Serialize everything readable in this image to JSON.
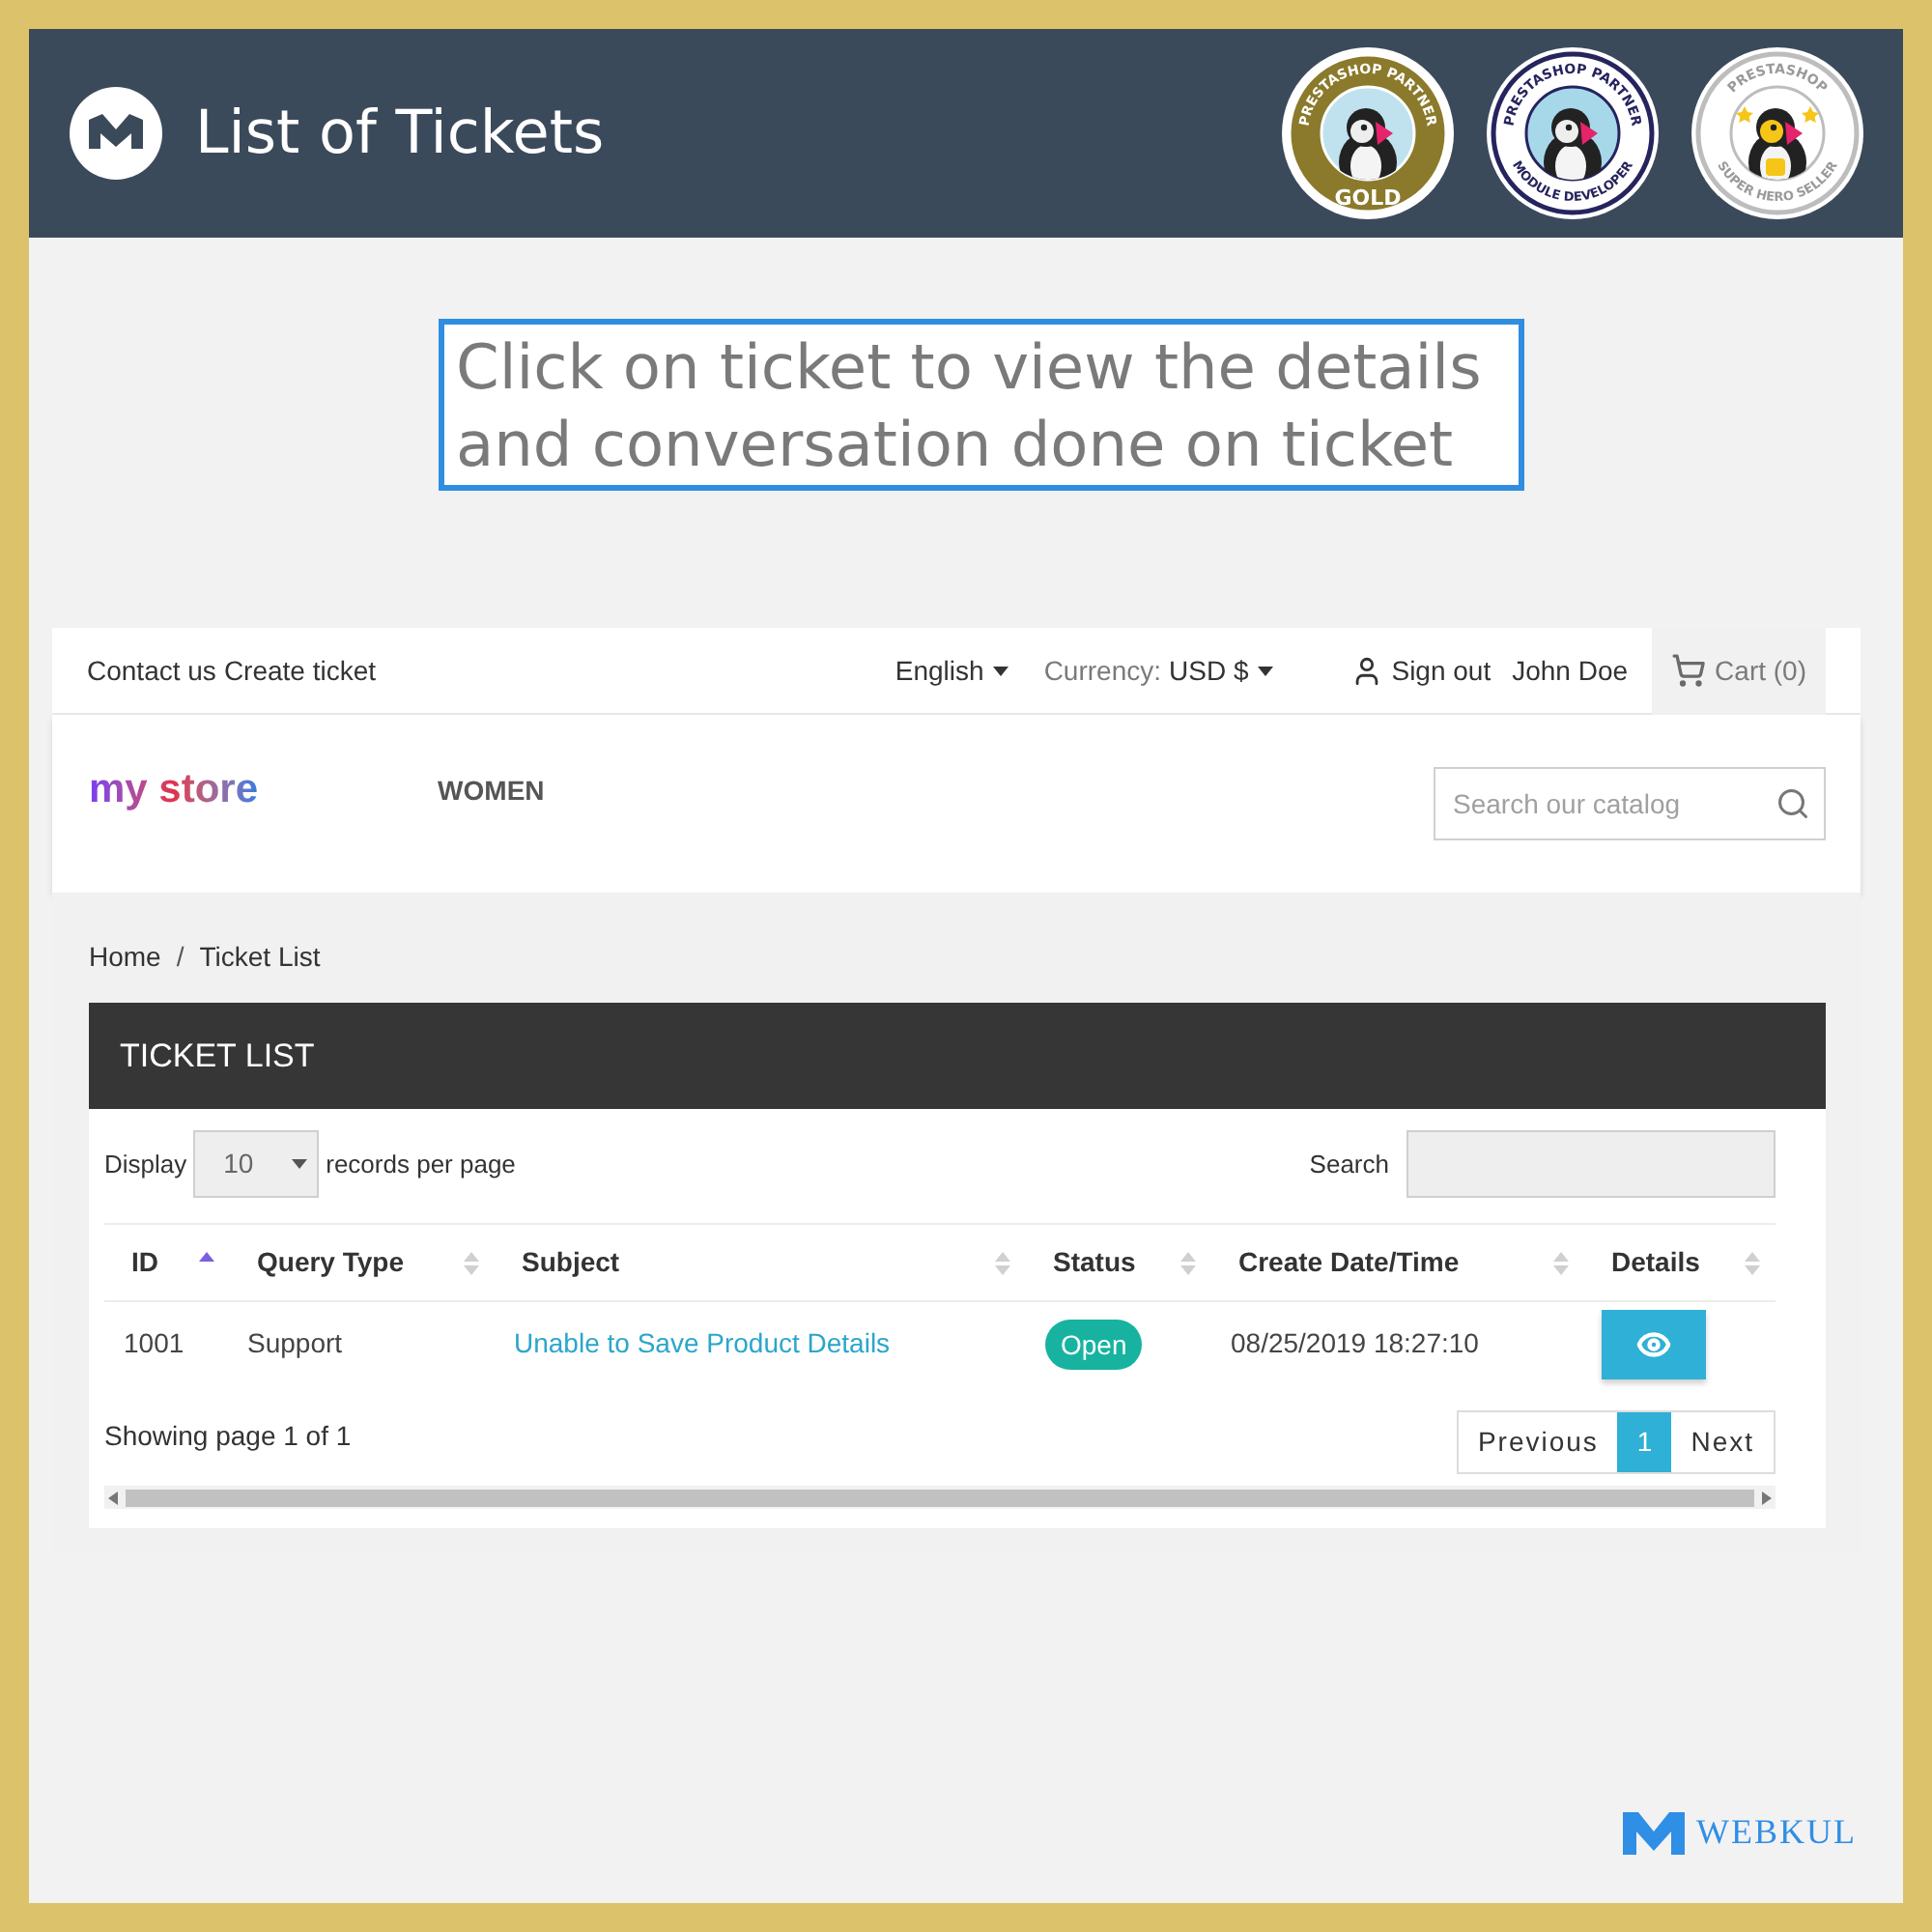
{
  "header": {
    "title": "List of Tickets",
    "badges": [
      {
        "kind": "gold",
        "top_text": "PRESTASHOP PARTNER",
        "bottom_text": "GOLD"
      },
      {
        "kind": "module",
        "top_text": "PRESTASHOP PARTNER",
        "bottom_text": "MODULE DEVELOPER"
      },
      {
        "kind": "hero",
        "top_text": "PRESTASHOP",
        "bottom_text": "SUPER HERO SELLER"
      }
    ]
  },
  "callout": {
    "text": "Click on ticket to view the details and conversation done on ticket"
  },
  "store": {
    "top_links": [
      "Contact us",
      "Create ticket"
    ],
    "language": "English",
    "currency_label": "Currency:",
    "currency": "USD $",
    "sign_out": "Sign out",
    "user_name": "John Doe",
    "cart": "Cart (0)",
    "logo": "my store",
    "menu": [
      "WOMEN"
    ],
    "search": {
      "placeholder": "Search our catalog"
    },
    "breadcrumb": [
      "Home",
      "Ticket List"
    ],
    "breadcrumb_separator": "/"
  },
  "ticket_list": {
    "title": "TICKET LIST",
    "display_label": "Display",
    "page_size": "10",
    "per_page_label": "records per page",
    "search_label": "Search",
    "columns": [
      {
        "label": "ID",
        "sorted": true
      },
      {
        "label": "Query Type",
        "sorted": false
      },
      {
        "label": "Subject",
        "sorted": false
      },
      {
        "label": "Status",
        "sorted": false
      },
      {
        "label": "Create Date/Time",
        "sorted": false
      },
      {
        "label": "Details",
        "sorted": false
      }
    ],
    "rows": [
      {
        "id": "1001",
        "query_type": "Support",
        "subject": "Unable to Save Product Details",
        "status": "Open",
        "created": "08/25/2019 18:27:10"
      }
    ],
    "summary": "Showing page 1 of 1",
    "pagination": [
      {
        "label": "Previous",
        "selected": false
      },
      {
        "label": "1",
        "selected": true
      },
      {
        "label": "Next",
        "selected": false
      }
    ]
  },
  "footer": {
    "brand": "WEBKUL"
  }
}
